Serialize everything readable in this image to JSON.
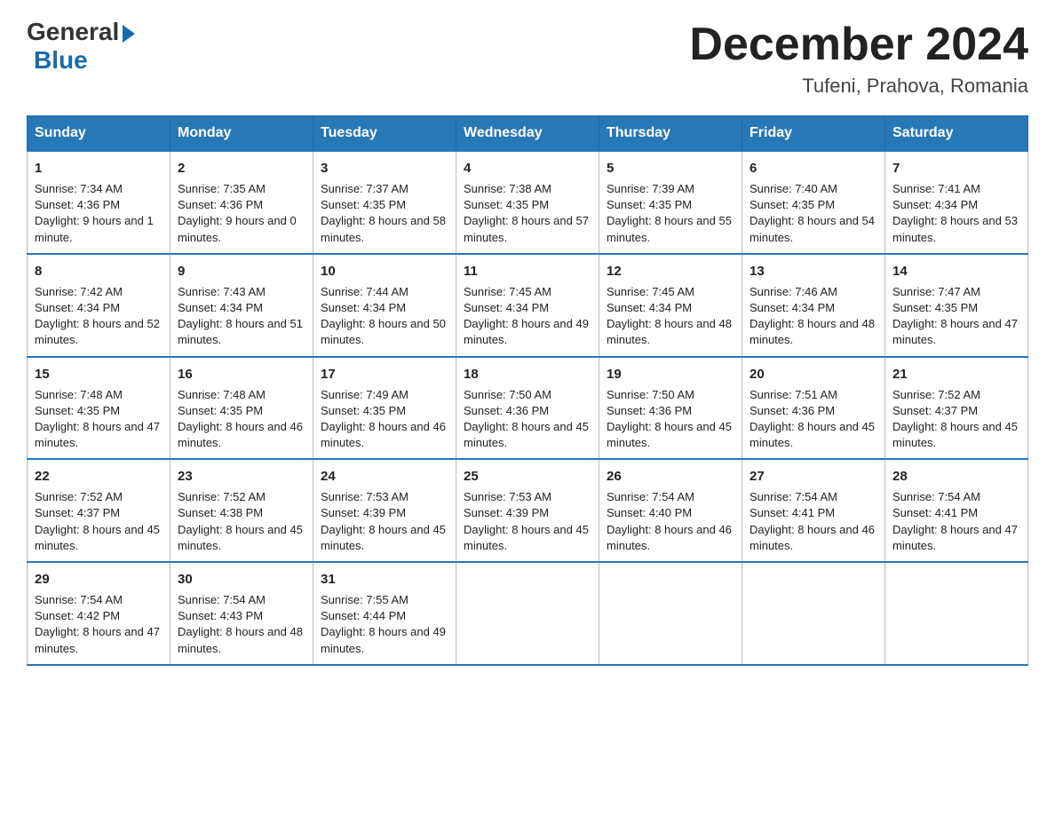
{
  "logo": {
    "general": "General",
    "blue": "Blue"
  },
  "title": "December 2024",
  "location": "Tufeni, Prahova, Romania",
  "days": [
    "Sunday",
    "Monday",
    "Tuesday",
    "Wednesday",
    "Thursday",
    "Friday",
    "Saturday"
  ],
  "weeks": [
    [
      {
        "num": "1",
        "sunrise": "7:34 AM",
        "sunset": "4:36 PM",
        "daylight": "9 hours and 1 minute."
      },
      {
        "num": "2",
        "sunrise": "7:35 AM",
        "sunset": "4:36 PM",
        "daylight": "9 hours and 0 minutes."
      },
      {
        "num": "3",
        "sunrise": "7:37 AM",
        "sunset": "4:35 PM",
        "daylight": "8 hours and 58 minutes."
      },
      {
        "num": "4",
        "sunrise": "7:38 AM",
        "sunset": "4:35 PM",
        "daylight": "8 hours and 57 minutes."
      },
      {
        "num": "5",
        "sunrise": "7:39 AM",
        "sunset": "4:35 PM",
        "daylight": "8 hours and 55 minutes."
      },
      {
        "num": "6",
        "sunrise": "7:40 AM",
        "sunset": "4:35 PM",
        "daylight": "8 hours and 54 minutes."
      },
      {
        "num": "7",
        "sunrise": "7:41 AM",
        "sunset": "4:34 PM",
        "daylight": "8 hours and 53 minutes."
      }
    ],
    [
      {
        "num": "8",
        "sunrise": "7:42 AM",
        "sunset": "4:34 PM",
        "daylight": "8 hours and 52 minutes."
      },
      {
        "num": "9",
        "sunrise": "7:43 AM",
        "sunset": "4:34 PM",
        "daylight": "8 hours and 51 minutes."
      },
      {
        "num": "10",
        "sunrise": "7:44 AM",
        "sunset": "4:34 PM",
        "daylight": "8 hours and 50 minutes."
      },
      {
        "num": "11",
        "sunrise": "7:45 AM",
        "sunset": "4:34 PM",
        "daylight": "8 hours and 49 minutes."
      },
      {
        "num": "12",
        "sunrise": "7:45 AM",
        "sunset": "4:34 PM",
        "daylight": "8 hours and 48 minutes."
      },
      {
        "num": "13",
        "sunrise": "7:46 AM",
        "sunset": "4:34 PM",
        "daylight": "8 hours and 48 minutes."
      },
      {
        "num": "14",
        "sunrise": "7:47 AM",
        "sunset": "4:35 PM",
        "daylight": "8 hours and 47 minutes."
      }
    ],
    [
      {
        "num": "15",
        "sunrise": "7:48 AM",
        "sunset": "4:35 PM",
        "daylight": "8 hours and 47 minutes."
      },
      {
        "num": "16",
        "sunrise": "7:48 AM",
        "sunset": "4:35 PM",
        "daylight": "8 hours and 46 minutes."
      },
      {
        "num": "17",
        "sunrise": "7:49 AM",
        "sunset": "4:35 PM",
        "daylight": "8 hours and 46 minutes."
      },
      {
        "num": "18",
        "sunrise": "7:50 AM",
        "sunset": "4:36 PM",
        "daylight": "8 hours and 45 minutes."
      },
      {
        "num": "19",
        "sunrise": "7:50 AM",
        "sunset": "4:36 PM",
        "daylight": "8 hours and 45 minutes."
      },
      {
        "num": "20",
        "sunrise": "7:51 AM",
        "sunset": "4:36 PM",
        "daylight": "8 hours and 45 minutes."
      },
      {
        "num": "21",
        "sunrise": "7:52 AM",
        "sunset": "4:37 PM",
        "daylight": "8 hours and 45 minutes."
      }
    ],
    [
      {
        "num": "22",
        "sunrise": "7:52 AM",
        "sunset": "4:37 PM",
        "daylight": "8 hours and 45 minutes."
      },
      {
        "num": "23",
        "sunrise": "7:52 AM",
        "sunset": "4:38 PM",
        "daylight": "8 hours and 45 minutes."
      },
      {
        "num": "24",
        "sunrise": "7:53 AM",
        "sunset": "4:39 PM",
        "daylight": "8 hours and 45 minutes."
      },
      {
        "num": "25",
        "sunrise": "7:53 AM",
        "sunset": "4:39 PM",
        "daylight": "8 hours and 45 minutes."
      },
      {
        "num": "26",
        "sunrise": "7:54 AM",
        "sunset": "4:40 PM",
        "daylight": "8 hours and 46 minutes."
      },
      {
        "num": "27",
        "sunrise": "7:54 AM",
        "sunset": "4:41 PM",
        "daylight": "8 hours and 46 minutes."
      },
      {
        "num": "28",
        "sunrise": "7:54 AM",
        "sunset": "4:41 PM",
        "daylight": "8 hours and 47 minutes."
      }
    ],
    [
      {
        "num": "29",
        "sunrise": "7:54 AM",
        "sunset": "4:42 PM",
        "daylight": "8 hours and 47 minutes."
      },
      {
        "num": "30",
        "sunrise": "7:54 AM",
        "sunset": "4:43 PM",
        "daylight": "8 hours and 48 minutes."
      },
      {
        "num": "31",
        "sunrise": "7:55 AM",
        "sunset": "4:44 PM",
        "daylight": "8 hours and 49 minutes."
      },
      null,
      null,
      null,
      null
    ]
  ]
}
